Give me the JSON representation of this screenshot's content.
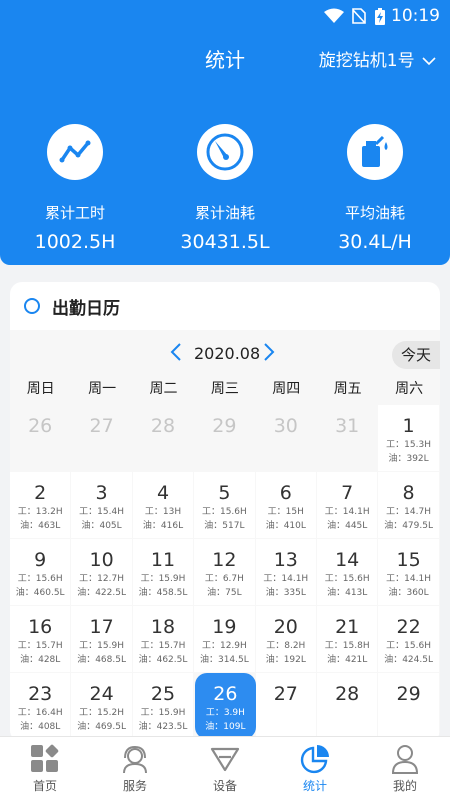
{
  "status_bar": {
    "time": "10:19"
  },
  "header": {
    "title": "统计",
    "device_selector": "旋挖钻机1号",
    "stats": [
      {
        "icon": "chart-line-icon",
        "label": "累计工时",
        "value": "1002.5H"
      },
      {
        "icon": "gauge-icon",
        "label": "累计油耗",
        "value": "30431.5L"
      },
      {
        "icon": "fuel-can-icon",
        "label": "平均油耗",
        "value": "30.4L/H"
      }
    ]
  },
  "attendance": {
    "title": "出勤日历",
    "month": "2020.08",
    "today_button": "今天",
    "weekdays": [
      "周日",
      "周一",
      "周二",
      "周三",
      "周四",
      "周五",
      "周六"
    ],
    "days": [
      {
        "d": "26",
        "dim": true
      },
      {
        "d": "27",
        "dim": true
      },
      {
        "d": "28",
        "dim": true
      },
      {
        "d": "29",
        "dim": true
      },
      {
        "d": "30",
        "dim": true
      },
      {
        "d": "31",
        "dim": true
      },
      {
        "d": "1",
        "w": "工：15.3H",
        "o": "油：392L"
      },
      {
        "d": "2",
        "w": "工：13.2H",
        "o": "油：463L"
      },
      {
        "d": "3",
        "w": "工：15.4H",
        "o": "油：405L"
      },
      {
        "d": "4",
        "w": "工：13H",
        "o": "油：416L"
      },
      {
        "d": "5",
        "w": "工：15.6H",
        "o": "油：517L"
      },
      {
        "d": "6",
        "w": "工：15H",
        "o": "油：410L"
      },
      {
        "d": "7",
        "w": "工：14.1H",
        "o": "油：445L"
      },
      {
        "d": "8",
        "w": "工：14.7H",
        "o": "油：479.5L"
      },
      {
        "d": "9",
        "w": "工：15.6H",
        "o": "油：460.5L"
      },
      {
        "d": "10",
        "w": "工：12.7H",
        "o": "油：422.5L"
      },
      {
        "d": "11",
        "w": "工：15.9H",
        "o": "油：458.5L"
      },
      {
        "d": "12",
        "w": "工：6.7H",
        "o": "油：75L"
      },
      {
        "d": "13",
        "w": "工：14.1H",
        "o": "油：335L"
      },
      {
        "d": "14",
        "w": "工：15.6H",
        "o": "油：413L"
      },
      {
        "d": "15",
        "w": "工：14.1H",
        "o": "油：360L"
      },
      {
        "d": "16",
        "w": "工：15.7H",
        "o": "油：428L"
      },
      {
        "d": "17",
        "w": "工：15.9H",
        "o": "油：468.5L"
      },
      {
        "d": "18",
        "w": "工：15.7H",
        "o": "油：462.5L"
      },
      {
        "d": "19",
        "w": "工：12.9H",
        "o": "油：314.5L"
      },
      {
        "d": "20",
        "w": "工：8.2H",
        "o": "油：192L"
      },
      {
        "d": "21",
        "w": "工：15.8H",
        "o": "油：421L"
      },
      {
        "d": "22",
        "w": "工：15.6H",
        "o": "油：424.5L"
      },
      {
        "d": "23",
        "w": "工：16.4H",
        "o": "油：408L"
      },
      {
        "d": "24",
        "w": "工：15.2H",
        "o": "油：469.5L"
      },
      {
        "d": "25",
        "w": "工：15.9H",
        "o": "油：423.5L"
      },
      {
        "d": "26",
        "w": "工：3.9H",
        "o": "油：109L",
        "selected": true
      },
      {
        "d": "27"
      },
      {
        "d": "28"
      },
      {
        "d": "29"
      }
    ]
  },
  "tabbar": [
    {
      "icon": "home-grid-icon",
      "label": "首页"
    },
    {
      "icon": "service-headset-icon",
      "label": "服务"
    },
    {
      "icon": "device-icon",
      "label": "设备"
    },
    {
      "icon": "pie-chart-icon",
      "label": "统计",
      "active": true
    },
    {
      "icon": "user-icon",
      "label": "我的"
    }
  ],
  "colors": {
    "primary": "#1a86f0",
    "selected_day": "#2d8cf0"
  }
}
